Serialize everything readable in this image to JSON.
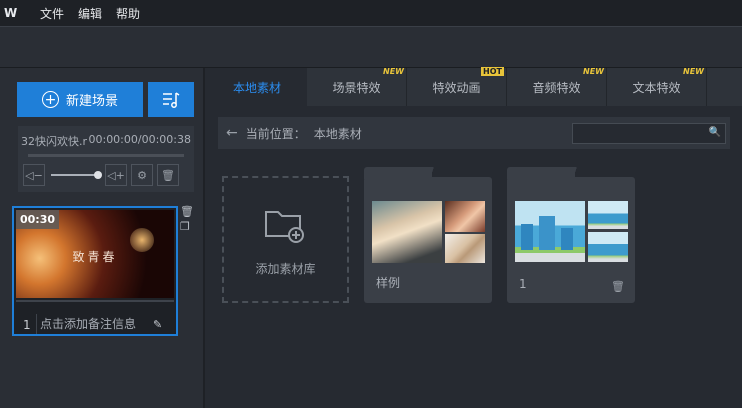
{
  "menubar": {
    "logo": "W",
    "items": [
      "文件",
      "编辑",
      "帮助"
    ]
  },
  "left": {
    "new_scene_label": "新建场景",
    "audio": {
      "name": "32快闪欢快.r",
      "time": "00:00:00/00:00:38"
    },
    "scene": {
      "duration": "00:30",
      "title": "致青春",
      "number": "1",
      "note_placeholder": "点击添加备注信息"
    }
  },
  "tabs": [
    {
      "label": "本地素材",
      "active": true,
      "badge": ""
    },
    {
      "label": "场景特效",
      "badge": "NEW"
    },
    {
      "label": "特效动画",
      "badge": "HOT"
    },
    {
      "label": "音频特效",
      "badge": "NEW"
    },
    {
      "label": "文本特效",
      "badge": "NEW"
    }
  ],
  "pathbar": {
    "label": "当前位置：",
    "value": "本地素材"
  },
  "library": {
    "add_label": "添加素材库",
    "folders": [
      {
        "label": "样例"
      },
      {
        "label": "1"
      }
    ]
  },
  "colors": {
    "accent": "#1f7fd8",
    "badge": "#e8c43a",
    "bg": "#262a31"
  }
}
